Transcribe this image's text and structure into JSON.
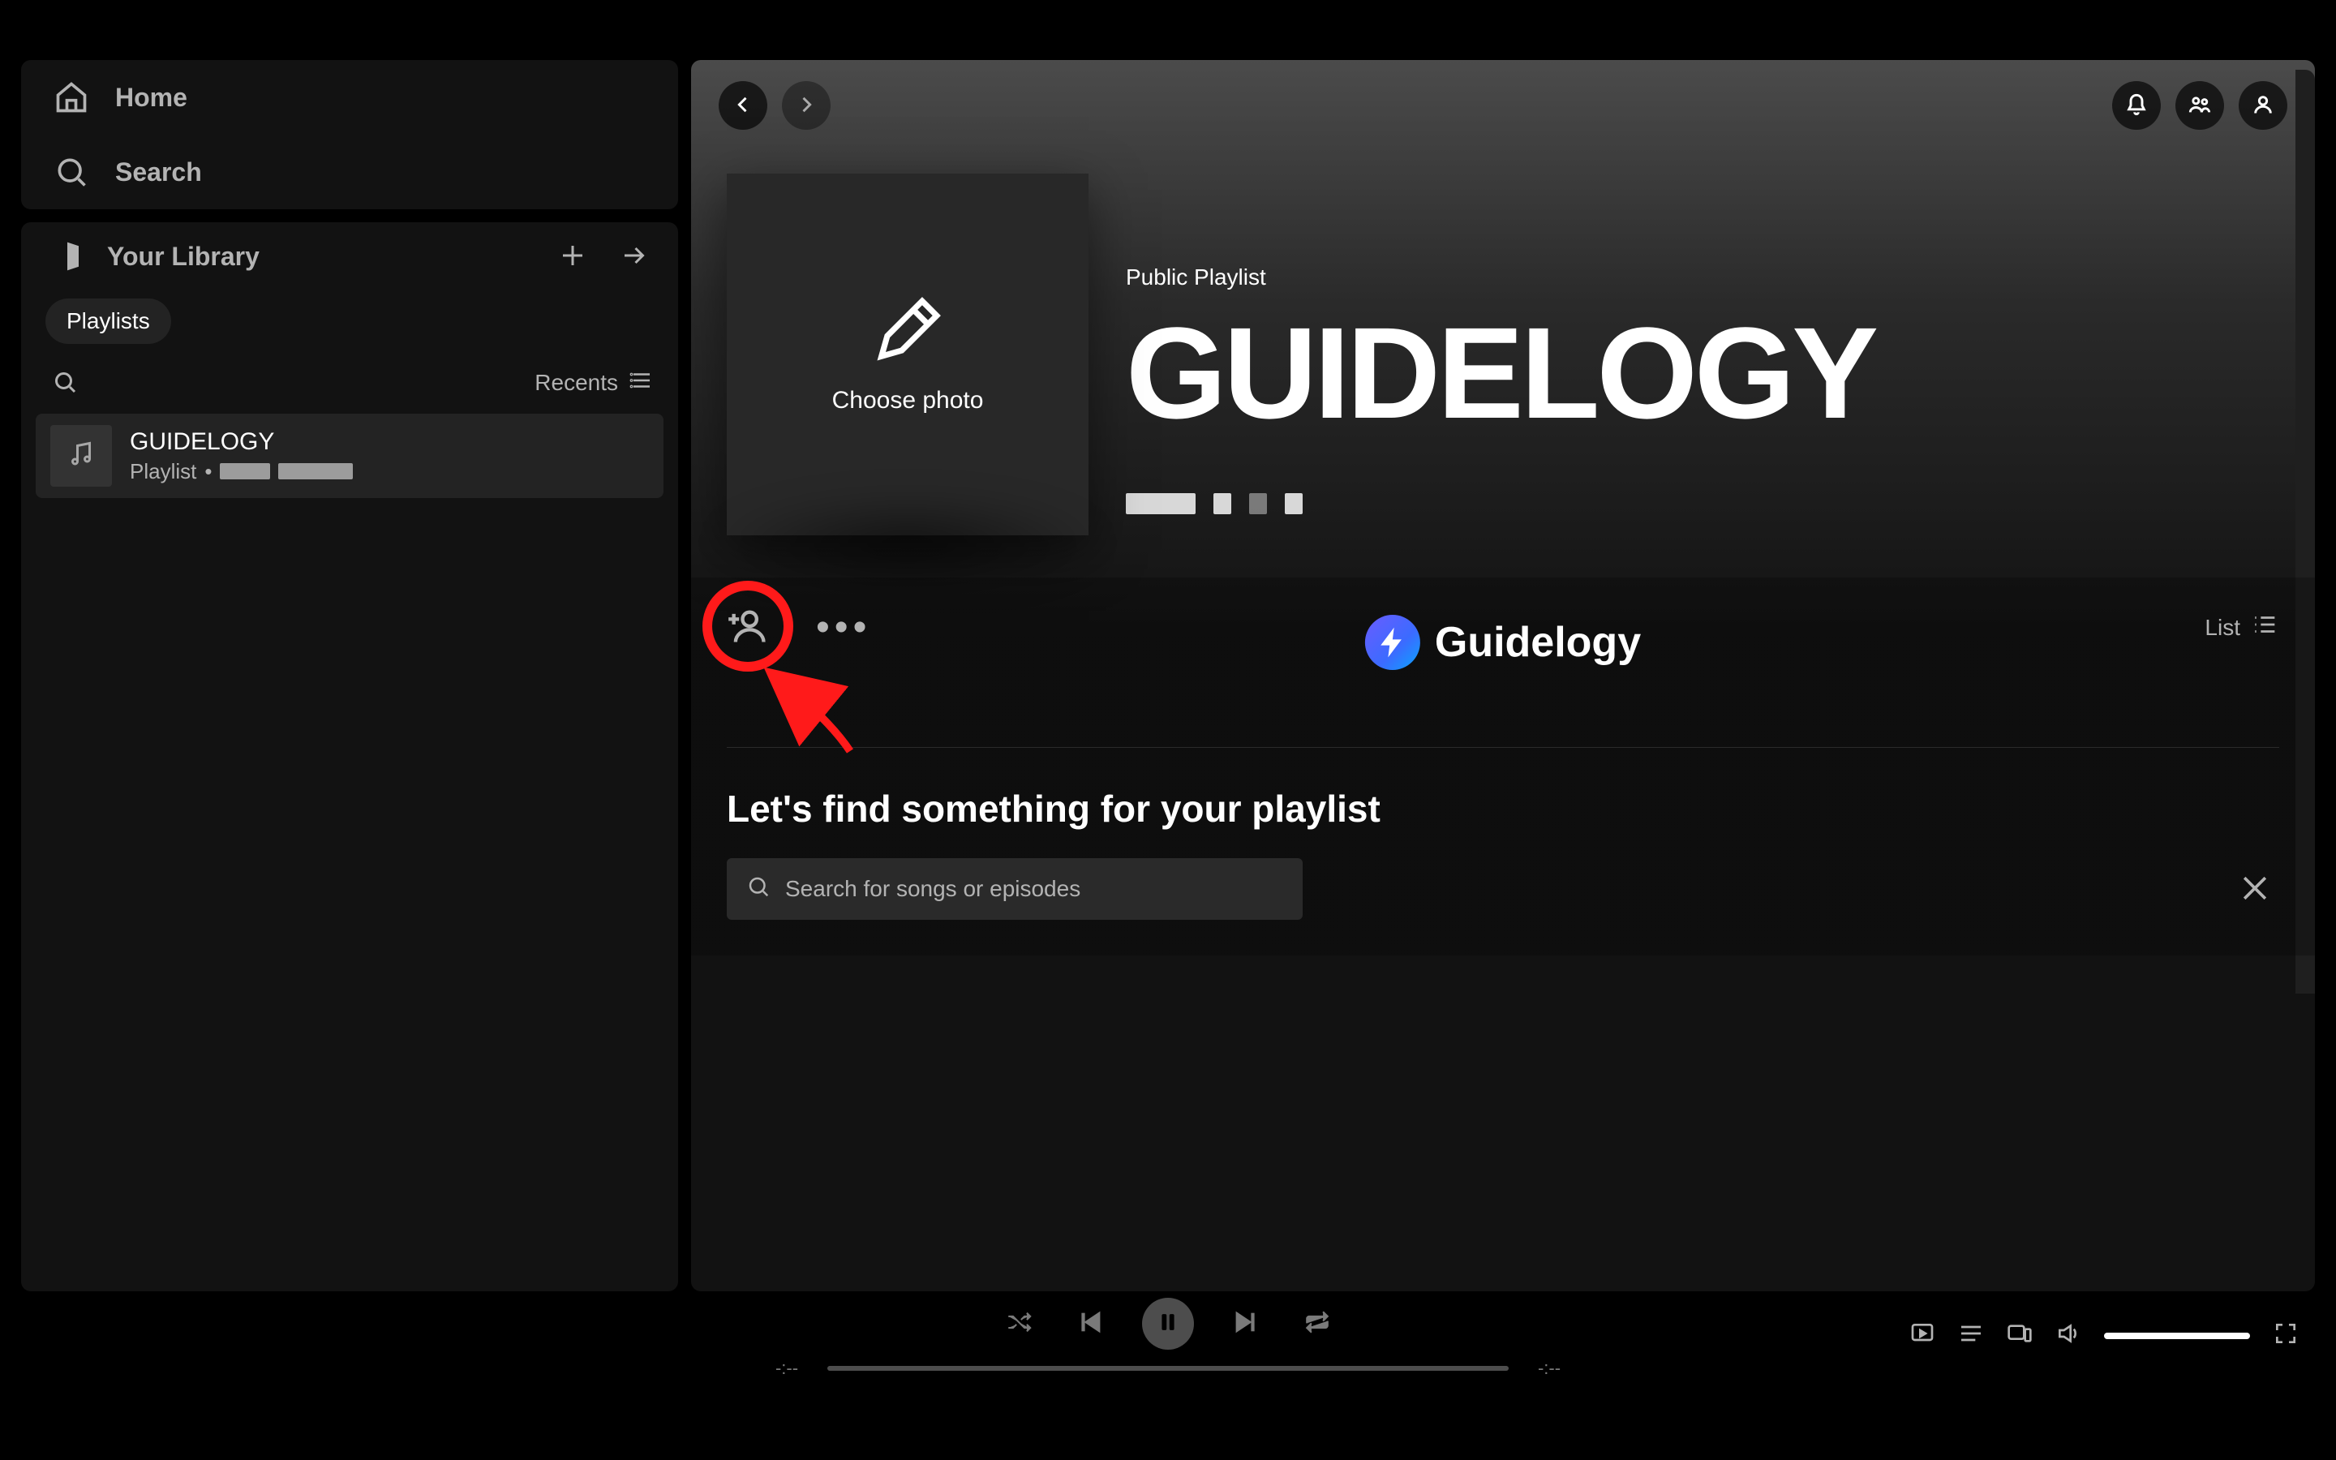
{
  "sidebar": {
    "home_label": "Home",
    "search_label": "Search",
    "library_label": "Your Library",
    "chips": [
      {
        "label": "Playlists"
      }
    ],
    "sort_label": "Recents",
    "items": [
      {
        "title": "GUIDELOGY",
        "subtitle": "Playlist"
      }
    ]
  },
  "header": {
    "type_label": "Public Playlist",
    "title": "GUIDELOGY",
    "choose_photo_label": "Choose photo"
  },
  "content": {
    "view_mode_label": "List",
    "watermark_text": "Guidelogy",
    "find_heading": "Let's find something for your playlist",
    "search_placeholder": "Search for songs or episodes"
  },
  "player": {
    "elapsed": "-:--",
    "remaining": "-:--"
  }
}
